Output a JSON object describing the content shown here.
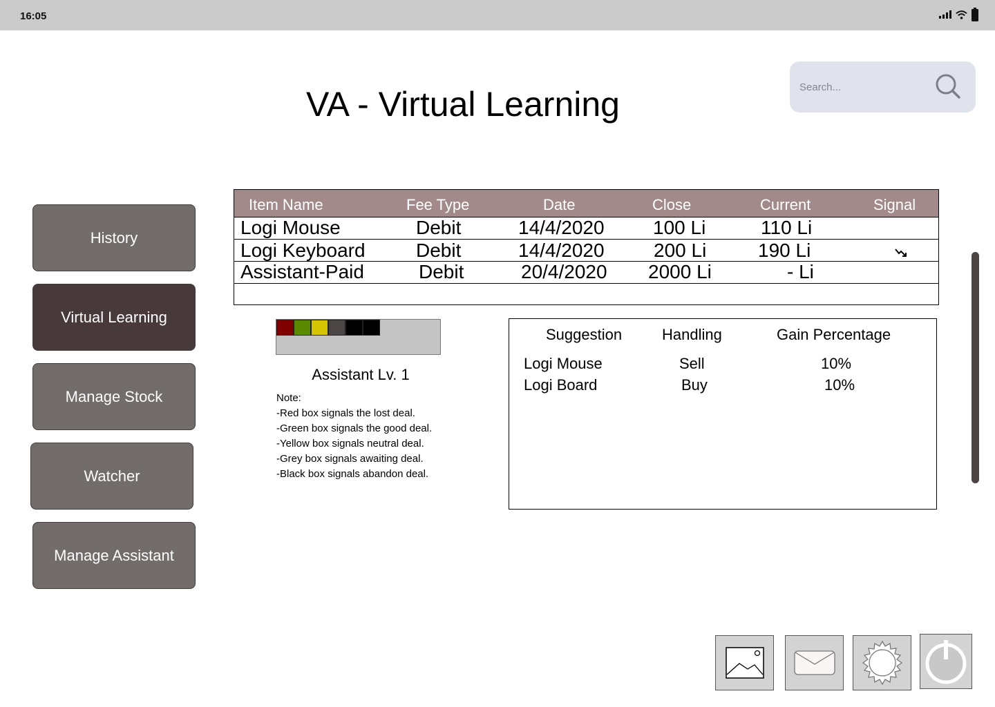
{
  "status_bar": {
    "time": "16:05"
  },
  "title": "VA - Virtual Learning",
  "search": {
    "placeholder": "Search..."
  },
  "sidebar": {
    "items": [
      {
        "label": "History"
      },
      {
        "label": "Virtual Learning",
        "active": true
      },
      {
        "label": "Manage Stock"
      },
      {
        "label": "Watcher"
      },
      {
        "label": "Manage Assistant"
      }
    ]
  },
  "transactions": {
    "headers": [
      "Item Name",
      "Fee Type",
      "Date",
      "Close",
      "Current",
      "Signal"
    ],
    "rows": [
      {
        "item": "Logi Mouse",
        "fee_type": "Debit",
        "date": "14/4/2020",
        "close": "100 Li",
        "current": "110 Li",
        "signal": ""
      },
      {
        "item": "Logi Keyboard",
        "fee_type": "Debit",
        "date": "14/4/2020",
        "close": "200 Li",
        "current": "190 Li",
        "signal": "trending-down-icon"
      },
      {
        "item": "Assistant-Paid",
        "fee_type": "Debit",
        "date": "20/4/2020",
        "close": "2000 Li",
        "current": "- Li",
        "signal": ""
      }
    ]
  },
  "signal_colors": {
    "red": "#800000",
    "green": "#5b8a00",
    "yellow": "#d4c500",
    "grey": "#4c4545",
    "black": "#000000"
  },
  "assistant": {
    "level": "Assistant Lv. 1",
    "notes": [
      "Note:",
      "-Red box signals the lost deal.",
      "-Green box signals the good deal.",
      "-Yellow box signals neutral deal.",
      "-Grey box signals awaiting deal.",
      "-Black box signals abandon deal."
    ]
  },
  "suggestions": {
    "headers": [
      "Suggestion",
      "Handling",
      "Gain Percentage"
    ],
    "rows": [
      {
        "suggestion": "Logi Mouse",
        "handling": "Sell",
        "gain": "10%"
      },
      {
        "suggestion": "Logi Board",
        "handling": "Buy",
        "gain": "10%"
      }
    ]
  },
  "dock": {
    "icons": [
      "image-icon",
      "mail-icon",
      "settings-icon",
      "power-icon"
    ]
  },
  "colors": {
    "nav_button": "#726c6b",
    "nav_button_active": "#483a3b",
    "table_header": "#a38a8a",
    "search_bg": "#e0e3eb",
    "status_bar": "#cbcbcb"
  }
}
